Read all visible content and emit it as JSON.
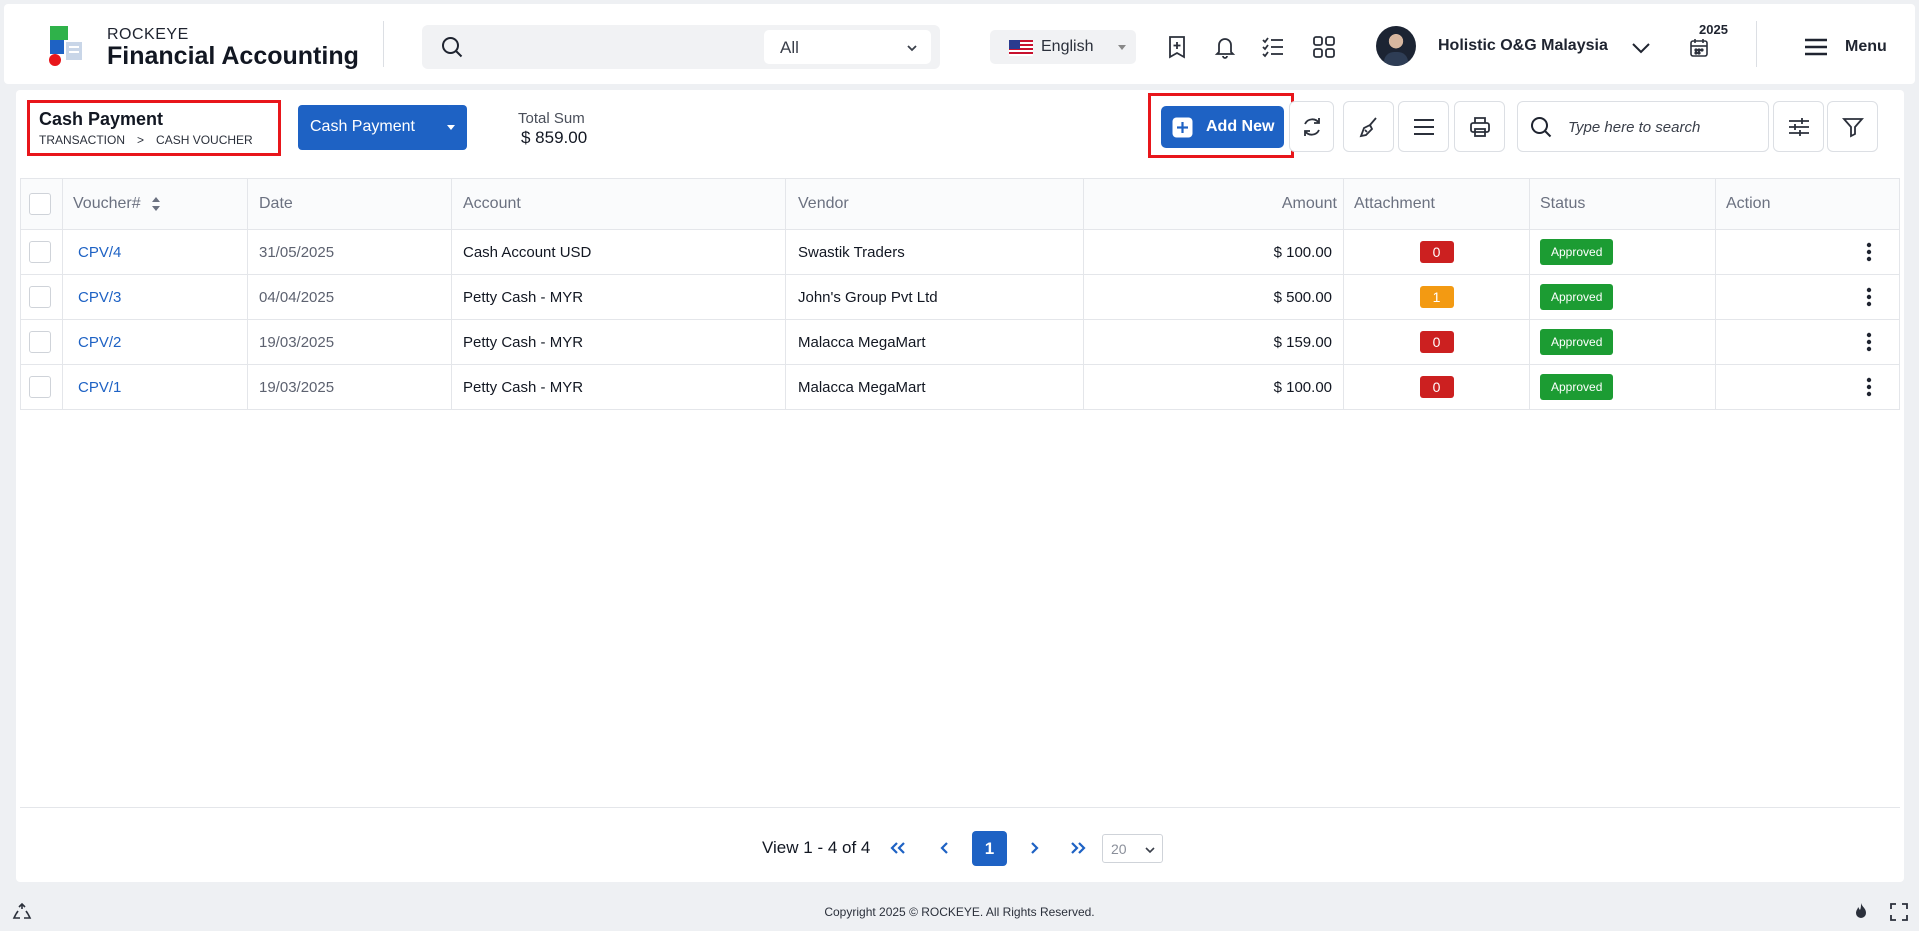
{
  "header": {
    "brand_small": "ROCKEYE",
    "brand_big": "Financial Accounting",
    "search_scope": "All",
    "language": "English",
    "company": "Holistic O&G Malaysia",
    "year": "2025",
    "menu_label": "Menu"
  },
  "page": {
    "title": "Cash Payment",
    "breadcrumb": [
      "TRANSACTION",
      ">",
      "CASH VOUCHER"
    ],
    "voucher_type": "Cash Payment",
    "total_label": "Total Sum",
    "total_value": "$ 859.00",
    "add_new_label": "Add New",
    "search_placeholder": "Type here to search"
  },
  "table": {
    "columns": [
      "Voucher#",
      "Date",
      "Account",
      "Vendor",
      "Amount",
      "Attachment",
      "Status",
      "Action"
    ],
    "rows": [
      {
        "voucher": "CPV/4",
        "date": "31/05/2025",
        "account": "Cash Account USD",
        "vendor": "Swastik Traders",
        "amount": "$ 100.00",
        "attachment": "0",
        "status": "Approved"
      },
      {
        "voucher": "CPV/3",
        "date": "04/04/2025",
        "account": "Petty Cash - MYR",
        "vendor": "John's Group Pvt Ltd",
        "amount": "$ 500.00",
        "attachment": "1",
        "status": "Approved"
      },
      {
        "voucher": "CPV/2",
        "date": "19/03/2025",
        "account": "Petty Cash - MYR",
        "vendor": "Malacca MegaMart",
        "amount": "$ 159.00",
        "attachment": "0",
        "status": "Approved"
      },
      {
        "voucher": "CPV/1",
        "date": "19/03/2025",
        "account": "Petty Cash - MYR",
        "vendor": "Malacca MegaMart",
        "amount": "$ 100.00",
        "attachment": "0",
        "status": "Approved"
      }
    ]
  },
  "pagination": {
    "summary": "View 1 - 4 of 4",
    "current_page": "1",
    "page_size": "20"
  },
  "footer": {
    "copyright": "Copyright 2025 © ROCKEYE. All Rights Reserved."
  },
  "colors": {
    "primary": "#1e62c4",
    "highlight_border": "#e8161b",
    "approved": "#1c9c33",
    "attachment_zero": "#cc2020",
    "attachment_some": "#f39a12"
  },
  "icons": {
    "search": "search-icon",
    "bookmark_add": "bookmark-add-icon",
    "bell": "bell-icon",
    "checklist": "checklist-icon",
    "apps": "apps-grid-icon",
    "calendar": "calendar-icon",
    "hamburger": "hamburger-menu-icon",
    "refresh": "refresh-icon",
    "broom": "clear-broom-icon",
    "list": "list-icon",
    "print": "print-icon",
    "settings_sliders": "sliders-icon",
    "filter": "filter-icon",
    "kebab": "kebab-menu-icon"
  }
}
